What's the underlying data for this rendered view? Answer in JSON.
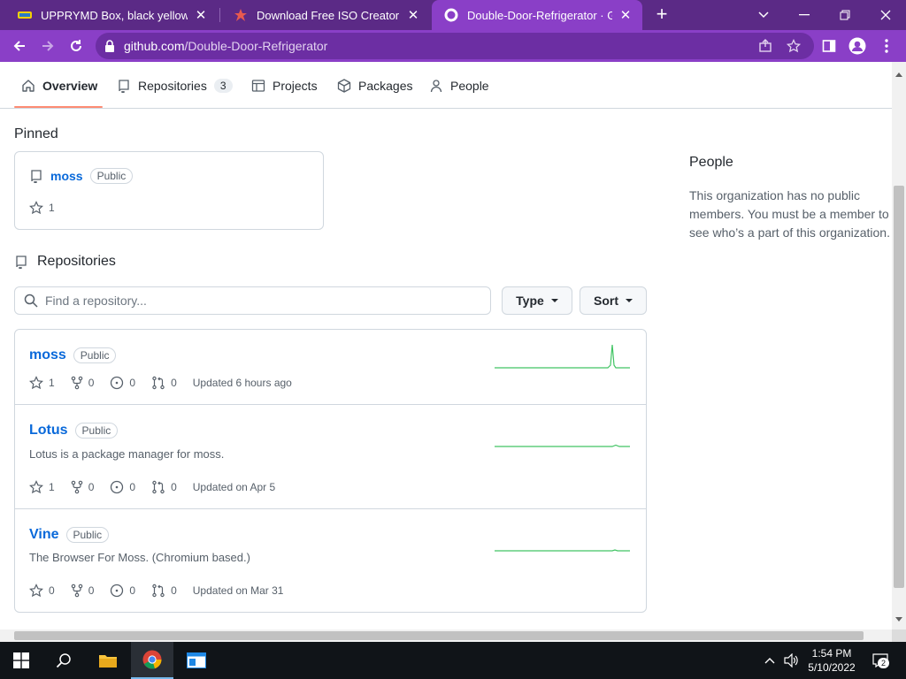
{
  "browser": {
    "tabs": [
      {
        "title": "UPPRYMD Box, black yellow/turq",
        "active": false
      },
      {
        "title": "Download Free ISO Creator",
        "active": false
      },
      {
        "title": "Double-Door-Refrigerator · GitHu",
        "active": true
      }
    ],
    "url_host": "github.com",
    "url_path": "/Double-Door-Refrigerator",
    "accent": "#8a3fc7"
  },
  "org_nav": {
    "overview": "Overview",
    "repositories": "Repositories",
    "repositories_count": "3",
    "projects": "Projects",
    "packages": "Packages",
    "people": "People"
  },
  "pinned": {
    "heading": "Pinned",
    "card": {
      "name": "moss",
      "visibility": "Public",
      "stars": "1"
    }
  },
  "repositories": {
    "heading": "Repositories",
    "search_placeholder": "Find a repository...",
    "type_label": "Type",
    "sort_label": "Sort",
    "items": [
      {
        "name": "moss",
        "visibility": "Public",
        "description": "",
        "stars": "1",
        "forks": "0",
        "issues": "0",
        "pulls": "0",
        "updated": "Updated 6 hours ago"
      },
      {
        "name": "Lotus",
        "visibility": "Public",
        "description": "Lotus is a package manager for moss.",
        "stars": "1",
        "forks": "0",
        "issues": "0",
        "pulls": "0",
        "updated": "Updated on Apr 5"
      },
      {
        "name": "Vine",
        "visibility": "Public",
        "description": "The Browser For Moss. (Chromium based.)",
        "stars": "0",
        "forks": "0",
        "issues": "0",
        "pulls": "0",
        "updated": "Updated on Mar 31"
      }
    ]
  },
  "sidebar": {
    "heading": "People",
    "text": "This organization has no public members. You must be a member to see who’s a part of this organization."
  },
  "taskbar": {
    "time": "1:54 PM",
    "date": "5/10/2022",
    "notifications": "2"
  }
}
